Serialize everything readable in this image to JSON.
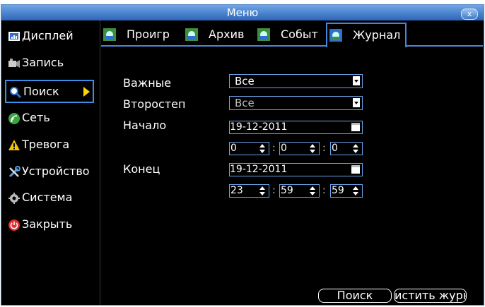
{
  "window": {
    "title": "Меню",
    "close_glyph": "x"
  },
  "sidebar": {
    "items": [
      {
        "label": "Дисплей",
        "icon": "display-icon"
      },
      {
        "label": "Запись",
        "icon": "record-icon"
      },
      {
        "label": "Поиск",
        "icon": "search-icon",
        "selected": true
      },
      {
        "label": "Сеть",
        "icon": "network-icon"
      },
      {
        "label": "Тревога",
        "icon": "alarm-icon"
      },
      {
        "label": "Устройство",
        "icon": "device-icon"
      },
      {
        "label": "Система",
        "icon": "system-icon"
      },
      {
        "label": "Закрыть",
        "icon": "power-icon"
      }
    ]
  },
  "tabs": [
    {
      "label": "Проигр",
      "icon": "playback-icon"
    },
    {
      "label": "Архив",
      "icon": "archive-icon"
    },
    {
      "label": "Событ",
      "icon": "event-icon"
    },
    {
      "label": "Журнал",
      "icon": "log-icon",
      "selected": true
    }
  ],
  "form": {
    "important_label": "Важные",
    "important_value": "Все",
    "secondary_label": "Второстеп",
    "secondary_value": "Все",
    "start_label": "Начало",
    "start_date": "19-12-2011",
    "start_hour": "0",
    "start_minute": "0",
    "start_second": "0",
    "end_label": "Конец",
    "end_date": "19-12-2011",
    "end_hour": "23",
    "end_minute": "59",
    "end_second": "59",
    "colon": ":"
  },
  "buttons": {
    "search": "Поиск",
    "clear": "истить журн"
  },
  "colors": {
    "accent": "#4a86d6",
    "titlebar": "#3c76c8",
    "background": "#000000"
  }
}
